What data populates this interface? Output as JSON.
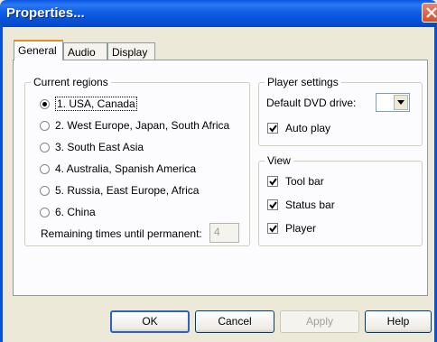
{
  "window": {
    "title": "Properties..."
  },
  "tabs": [
    {
      "label": "General",
      "selected": true
    },
    {
      "label": "Audio",
      "selected": false
    },
    {
      "label": "Display",
      "selected": false
    }
  ],
  "regions": {
    "group_title": "Current regions",
    "options": [
      {
        "label": "1. USA, Canada",
        "selected": true
      },
      {
        "label": "2. West Europe, Japan, South Africa",
        "selected": false
      },
      {
        "label": "3. South East Asia",
        "selected": false
      },
      {
        "label": "4. Australia, Spanish America",
        "selected": false
      },
      {
        "label": "5. Russia, East Europe, Africa",
        "selected": false
      },
      {
        "label": "6. China",
        "selected": false
      }
    ],
    "remaining_label": "Remaining times until permanent:",
    "remaining_value": "4"
  },
  "player_settings": {
    "group_title": "Player settings",
    "dvd_drive_label": "Default DVD drive:",
    "dvd_drive_value": "",
    "auto_play_label": "Auto play",
    "auto_play_checked": true
  },
  "view": {
    "group_title": "View",
    "items": [
      {
        "label": "Tool bar",
        "checked": true
      },
      {
        "label": "Status bar",
        "checked": true
      },
      {
        "label": "Player",
        "checked": true
      }
    ]
  },
  "buttons": {
    "ok": "OK",
    "cancel": "Cancel",
    "apply": "Apply",
    "help": "Help"
  },
  "colors": {
    "title_bar": "#0751d8",
    "dialog_face": "#ece9d8",
    "close_button": "#d4502e",
    "active_tab_accent": "#e68b2c"
  },
  "icons": {
    "close": "close-icon",
    "dropdown": "chevron-down-icon",
    "check": "check-icon"
  }
}
